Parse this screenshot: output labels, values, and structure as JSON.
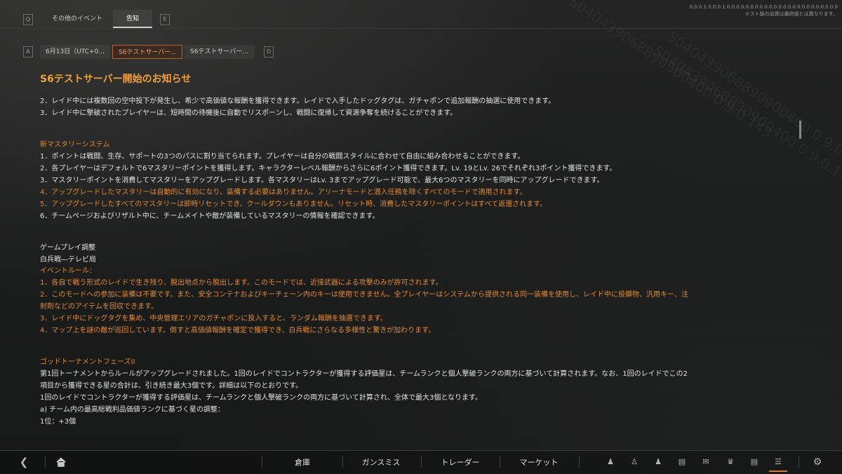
{
  "top_tabs": {
    "left_key": "Q",
    "right_key": "E",
    "tabs": [
      {
        "label": "その他のイベント"
      },
      {
        "label": "告知"
      }
    ]
  },
  "corner_text": {
    "line1": "0.0.0.1.0.0.0.1.0.0.0.0.0.0.0.0.0.0.0.0.0.0.0.0.0.0.0.0.0.0.0.0",
    "line2": "テスト版の品質は最終版とは異なります。"
  },
  "sub_tabs": {
    "left_key": "A",
    "right_key": "D",
    "tabs": [
      {
        "label": "6月13日（UTC+0..."
      },
      {
        "label": "S6テストサーバー..."
      },
      {
        "label": "S6テストサーバー..."
      }
    ]
  },
  "article": {
    "title": "S6テストサーバー開始のお知らせ",
    "lines": [
      {
        "text": "2．レイド中には複数回の空中投下が発生し、希少で高価値な報酬を獲得できます。レイドで入手したドッグタグは、ガチャポンで追加報酬の抽選に使用できます。",
        "color": "w"
      },
      {
        "text": "3．レイド中に撃破されたプレイヤーは、短時間の待機後に自動でリスポーンし、戦闘に復帰して資源争奪を続けることができます。",
        "color": "w"
      },
      {
        "text": "新マスタリーシステム",
        "color": "o"
      },
      {
        "text": "1．ポイントは戦闘、生存、サポートの3つのパスに割り当てられます。プレイヤーは自分の戦闘スタイルに合わせて自由に組み合わせることができます。",
        "color": "w"
      },
      {
        "text": "2．各プレイヤーはデフォルトで6マスタリーポイントを獲得します。キャラクターレベル報酬からさらに6ポイント獲得できます。Lv. 19とLv. 26でそれぞれ3ポイント獲得できます。",
        "color": "w"
      },
      {
        "text": "3．マスタリーポイントを消費してマスタリーをアップグレードします。各マスタリーはLv. 3までアップグレード可能で、最大6つのマスタリーを同時にアップグレードできます。",
        "color": "w"
      },
      {
        "text": "4．アップグレードしたマスタリーは自動的に有効になり、装備する必要はありません。アリーナモードと潜入任務を除くすべてのモードで適用されます。",
        "color": "o"
      },
      {
        "text": "5．アップグレードしたすべてのマスタリーは即時リセットでき、クールダウンもありません。リセット時、消費したマスタリーポイントはすべて返還されます。",
        "color": "o"
      },
      {
        "text": "6．チームページおよびリザルト中に、チームメイトや敵が装備しているマスタリーの情報を確認できます。",
        "color": "w"
      },
      {
        "text": "ゲームプレイ調整",
        "color": "w"
      },
      {
        "text": "白兵戦―テレビ局",
        "color": "w"
      },
      {
        "text": "イベントルール：",
        "color": "o"
      },
      {
        "text": "1．各自で戦う形式のレイドで生き残り、脱出地点から脱出します。このモードでは、近接武器による攻撃のみが許可されます。",
        "color": "o"
      },
      {
        "text": "2．このモードへの参加に装備は不要です。また、安全コンテナおよびキーチェーン内のキーは使用できません。全プレイヤーはシステムから提供される同一装備を使用し、レイド中に投擲物、汎用キー、注",
        "color": "o"
      },
      {
        "text": "射剤などのアイテムを回収できます。",
        "color": "o"
      },
      {
        "text": "3．レイド中にドッグタグを集め、中央管理エリアのガチャポンに投入すると、ランダム報酬を抽選できます。",
        "color": "o"
      },
      {
        "text": "4．マップ上を謎の敵が巡回しています。倒すと高価値報酬を確定で獲得でき、白兵戦にさらなる多様性と驚きが加わります。",
        "color": "o"
      },
      {
        "text": "ゴッドトーナメントフェーズII",
        "color": "o"
      },
      {
        "text": "第1回トーナメントからルールがアップグレードされました。1回のレイドでコントラクターが獲得する評価星は、チームランクと個人撃破ランクの両方に基づいて計算されます。なお、1回のレイドでこの2",
        "color": "w"
      },
      {
        "text": "項目から獲得できる星の合計は、引き続き最大3個です。詳細は以下のとおりです。",
        "color": "w"
      },
      {
        "text": "1回のレイドでコントラクターが獲得する評価星は、チームランクと個人撃破ランクの両方に基づいて計算され、全体で最大3個となります。",
        "color": "w"
      },
      {
        "text": "a) チーム内の最高総戦利品価値ランクに基づく星の調整：",
        "color": "w"
      },
      {
        "text": "1位：+3個",
        "color": "w"
      }
    ]
  },
  "watermark": "5040439068890900400 0.9.0.143",
  "bottom_nav": {
    "items": [
      {
        "label": "倉庫"
      },
      {
        "label": "ガンスミス"
      },
      {
        "label": "トレーダー"
      },
      {
        "label": "マーケット"
      }
    ],
    "icons": [
      "back-arrow-icon",
      "home-icon",
      "character-icon",
      "squad-icon",
      "friends-icon",
      "chat-icon",
      "mail-icon",
      "trophy-icon",
      "document-icon",
      "tasks-icon",
      "settings-icon"
    ]
  }
}
